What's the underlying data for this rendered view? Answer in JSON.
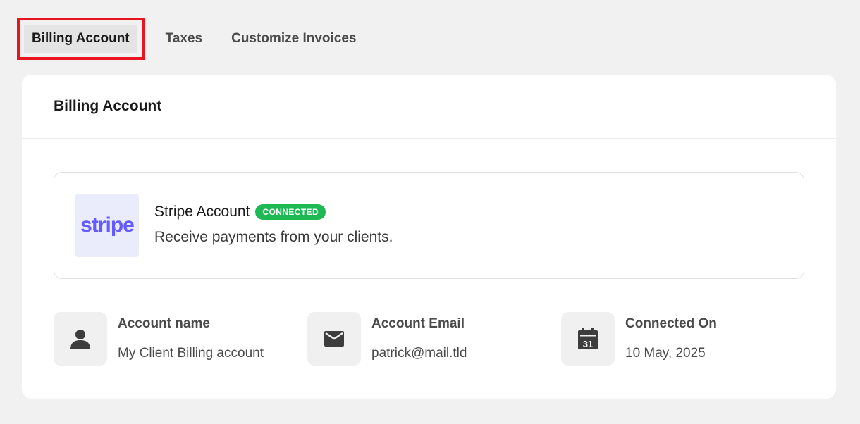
{
  "tabs": [
    {
      "label": "Billing Account",
      "active": true
    },
    {
      "label": "Taxes",
      "active": false
    },
    {
      "label": "Customize Invoices",
      "active": false
    }
  ],
  "card": {
    "title": "Billing Account",
    "stripe": {
      "logo_text": "stripe",
      "title": "Stripe Account",
      "badge": "CONNECTED",
      "description": "Receive payments from your clients."
    },
    "details": [
      {
        "label": "Account name",
        "value": "My Client Billing account",
        "icon": "user-icon"
      },
      {
        "label": "Account Email",
        "value": "patrick@mail.tld",
        "icon": "mail-icon"
      },
      {
        "label": "Connected On",
        "value": "10 May, 2025",
        "icon": "calendar-icon",
        "icon_text": "31"
      }
    ]
  },
  "colors": {
    "accent_highlight": "#e8141f",
    "badge_green": "#1eb955",
    "stripe_purple": "#635bff",
    "background": "#f1f1f1"
  }
}
